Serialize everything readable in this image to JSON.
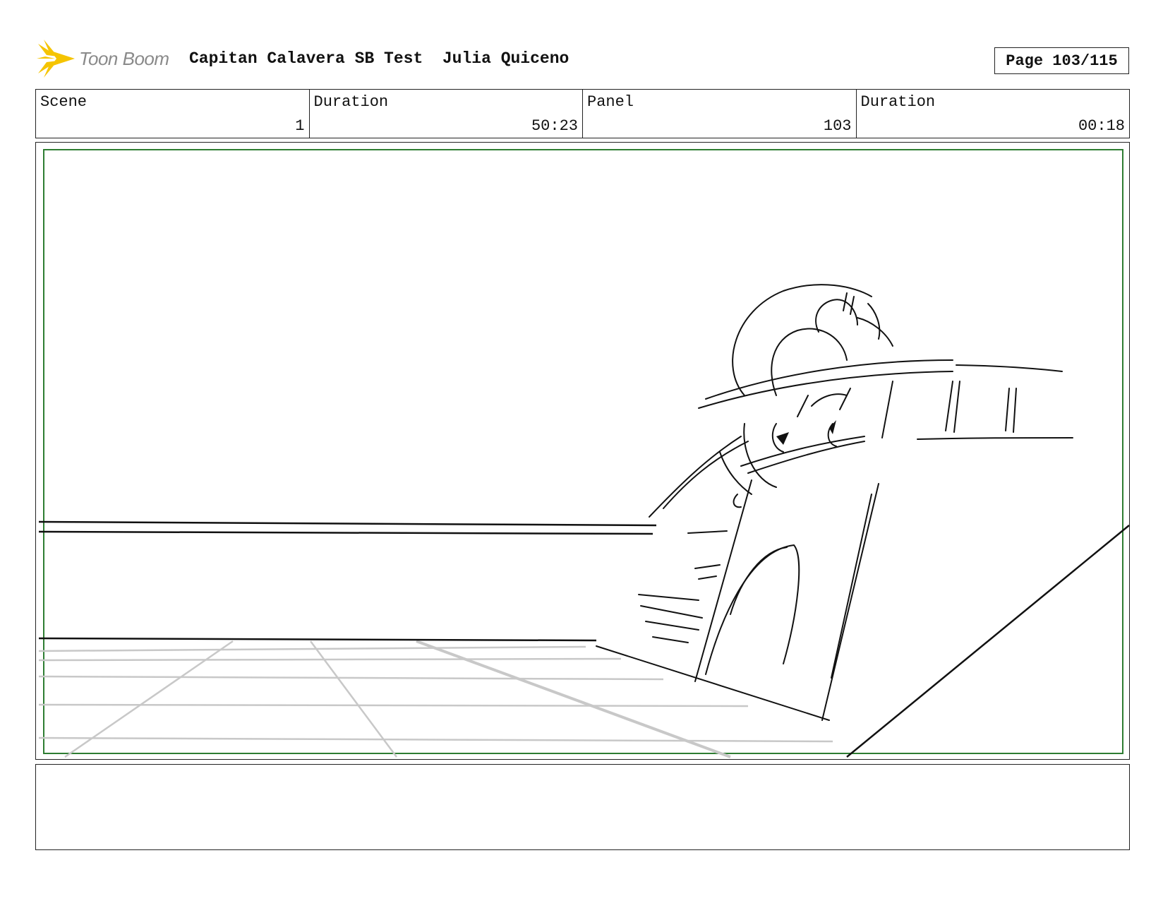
{
  "header": {
    "logo_text": "Toon Boom",
    "project_title": "Capitan Calavera SB Test",
    "artist": "Julia Quiceno",
    "page_label": "Page 103/115"
  },
  "info": {
    "scene_label": "Scene",
    "scene_value": "1",
    "scene_duration_label": "Duration",
    "scene_duration_value": "50:23",
    "panel_label": "Panel",
    "panel_value": "103",
    "panel_duration_label": "Duration",
    "panel_duration_value": "00:18"
  },
  "notes": {
    "text": ""
  },
  "colors": {
    "safe_frame": "#2e7d32",
    "logo_sun": "#f5c400",
    "logo_text": "#8a8a8a",
    "floor_lines": "#c8c8c8"
  }
}
